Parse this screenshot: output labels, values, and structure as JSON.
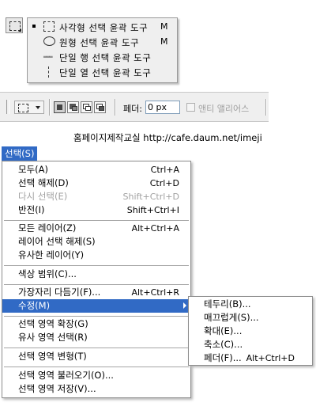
{
  "flyout": {
    "items": [
      {
        "label": "사각형 선택 윤곽 도구",
        "shortcut": "M",
        "icon": "rect-marquee-icon",
        "selected": true
      },
      {
        "label": "원형 선택 윤곽 도구",
        "shortcut": "M",
        "icon": "elliptical-marquee-icon",
        "selected": false
      },
      {
        "label": "단일 행 선택 윤곽 도구",
        "shortcut": "",
        "icon": "single-row-marquee-icon",
        "selected": false
      },
      {
        "label": "단일 열 선택 윤곽 도구",
        "shortcut": "",
        "icon": "single-column-marquee-icon",
        "selected": false
      }
    ]
  },
  "options_bar": {
    "feather_label": "페더:",
    "feather_value": "0 px",
    "anti_alias_label": "앤티 앨리어스",
    "anti_alias_checked": false
  },
  "caption": "홈페이지제작교실 http://cafe.daum.net/imeji",
  "menu": {
    "title": "선택(S)",
    "items": [
      {
        "label": "모두(A)",
        "shortcut": "Ctrl+A",
        "disabled": false
      },
      {
        "label": "선택 해제(D)",
        "shortcut": "Ctrl+D",
        "disabled": false
      },
      {
        "label": "다시 선택(E)",
        "shortcut": "Shift+Ctrl+D",
        "disabled": true
      },
      {
        "label": "반전(I)",
        "shortcut": "Shift+Ctrl+I",
        "disabled": false
      },
      {
        "label": "모든 레이어(Z)",
        "shortcut": "Alt+Ctrl+A",
        "disabled": false
      },
      {
        "label": "레이어 선택 해제(S)",
        "shortcut": "",
        "disabled": false
      },
      {
        "label": "유사한 레이어(Y)",
        "shortcut": "",
        "disabled": false
      },
      {
        "label": "색상 범위(C)...",
        "shortcut": "",
        "disabled": false
      },
      {
        "label": "가장자리 다듬기(F)...",
        "shortcut": "Alt+Ctrl+R",
        "disabled": false
      },
      {
        "label": "수정(M)",
        "shortcut": "",
        "disabled": false,
        "highlighted": true,
        "submenu": true
      },
      {
        "label": "선택 영역 확장(G)",
        "shortcut": "",
        "disabled": false
      },
      {
        "label": "유사 영역 선택(R)",
        "shortcut": "",
        "disabled": false
      },
      {
        "label": "선택 영역 변형(T)",
        "shortcut": "",
        "disabled": false
      },
      {
        "label": "선택 영역 불러오기(O)...",
        "shortcut": "",
        "disabled": false
      },
      {
        "label": "선택 영역 저장(V)...",
        "shortcut": "",
        "disabled": false
      }
    ]
  },
  "submenu": {
    "items": [
      {
        "label": "테두리(B)...",
        "shortcut": ""
      },
      {
        "label": "매끄럽게(S)...",
        "shortcut": ""
      },
      {
        "label": "확대(E)...",
        "shortcut": ""
      },
      {
        "label": "축소(C)...",
        "shortcut": ""
      },
      {
        "label": "페더(F)...",
        "shortcut": "Alt+Ctrl+D"
      }
    ]
  },
  "colors": {
    "highlight": "#316ac5",
    "disabled_text": "#a2a2a2",
    "panel_bg": "#efefef"
  }
}
